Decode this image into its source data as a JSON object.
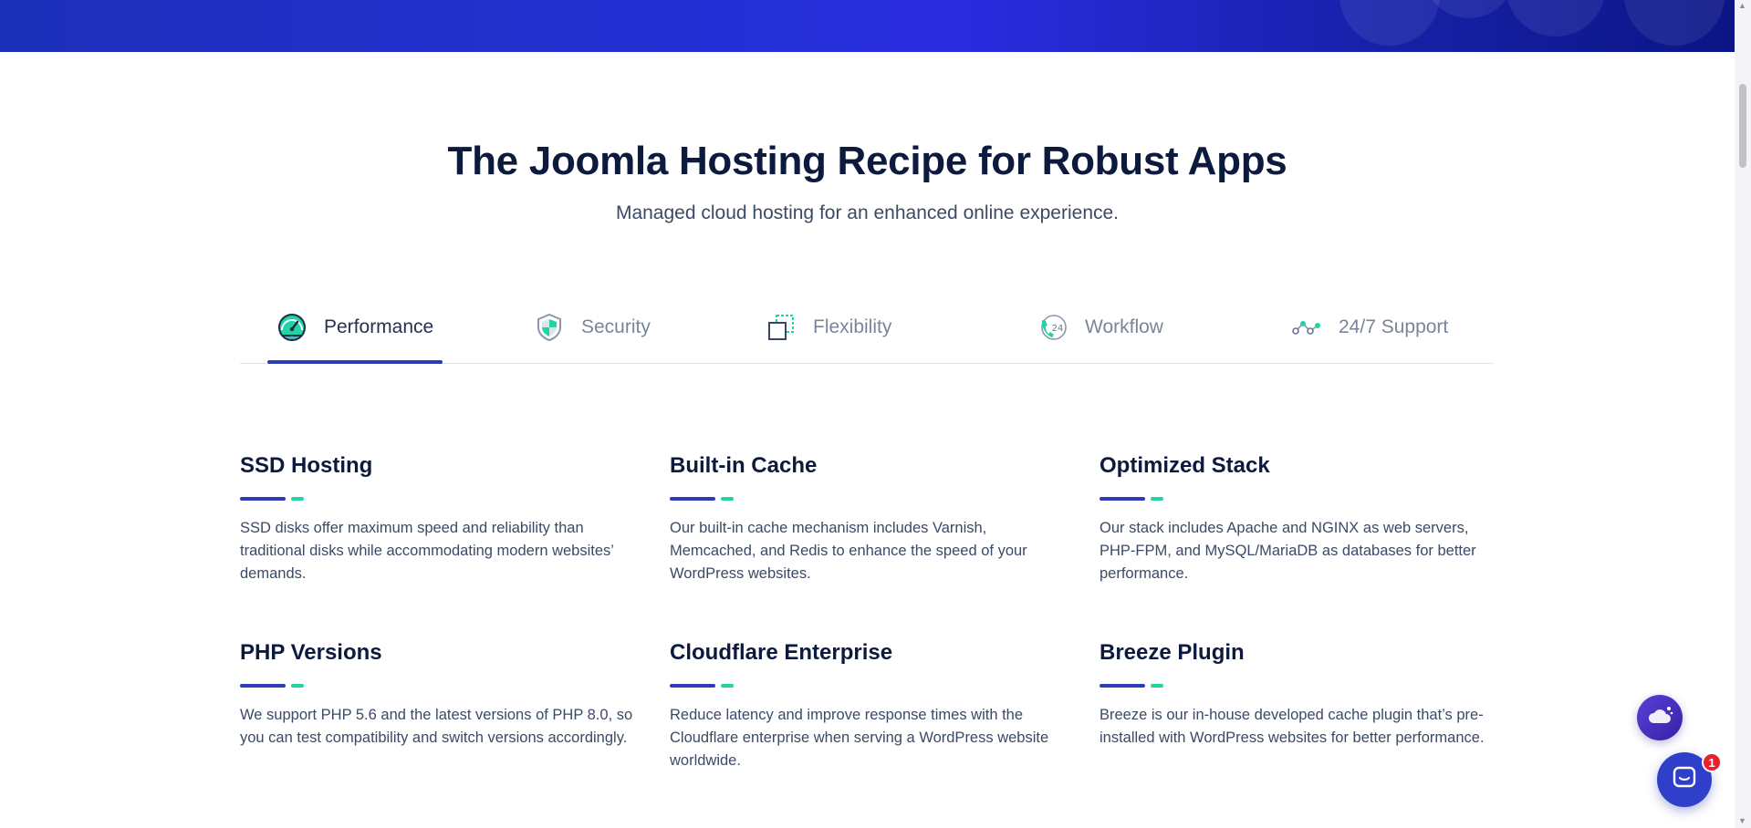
{
  "header": {
    "title": "The Joomla Hosting Recipe for Robust Apps",
    "subtitle": "Managed cloud hosting for an enhanced online experience."
  },
  "tabs": [
    {
      "label": "Performance",
      "icon": "speedometer-icon",
      "active": true
    },
    {
      "label": "Security",
      "icon": "shield-icon",
      "active": false
    },
    {
      "label": "Flexibility",
      "icon": "overlapping-squares-icon",
      "active": false
    },
    {
      "label": "Workflow",
      "icon": "phone-24-icon",
      "active": false
    },
    {
      "label": "24/7 Support",
      "icon": "connected-nodes-icon",
      "active": false
    }
  ],
  "features": [
    {
      "title": "SSD Hosting",
      "description": "SSD disks offer maximum speed and reliability than traditional disks while accommodating modern websites’ demands."
    },
    {
      "title": "Built-in Cache",
      "description": "Our built-in cache mechanism includes Varnish, Memcached, and Redis to enhance the speed of your WordPress websites."
    },
    {
      "title": "Optimized Stack",
      "description": "Our stack includes Apache and NGINX as web servers, PHP-FPM, and MySQL/MariaDB as databases for better performance."
    },
    {
      "title": "PHP Versions",
      "description": "We support PHP 5.6 and the latest versions of PHP 8.0, so you can test compatibility and switch versions accordingly."
    },
    {
      "title": "Cloudflare Enterprise",
      "description": "Reduce latency and improve response times with the Cloudflare enterprise when serving a WordPress website worldwide."
    },
    {
      "title": "Breeze Plugin",
      "description": "Breeze is our in-house developed cache plugin that’s pre-installed with WordPress websites for better performance."
    }
  ],
  "chat": {
    "unread_count": "1"
  },
  "colors": {
    "primary": "#2c3bb8",
    "accent": "#22d3a6",
    "heading": "#0b1a3d",
    "banner": "#2530d8"
  }
}
